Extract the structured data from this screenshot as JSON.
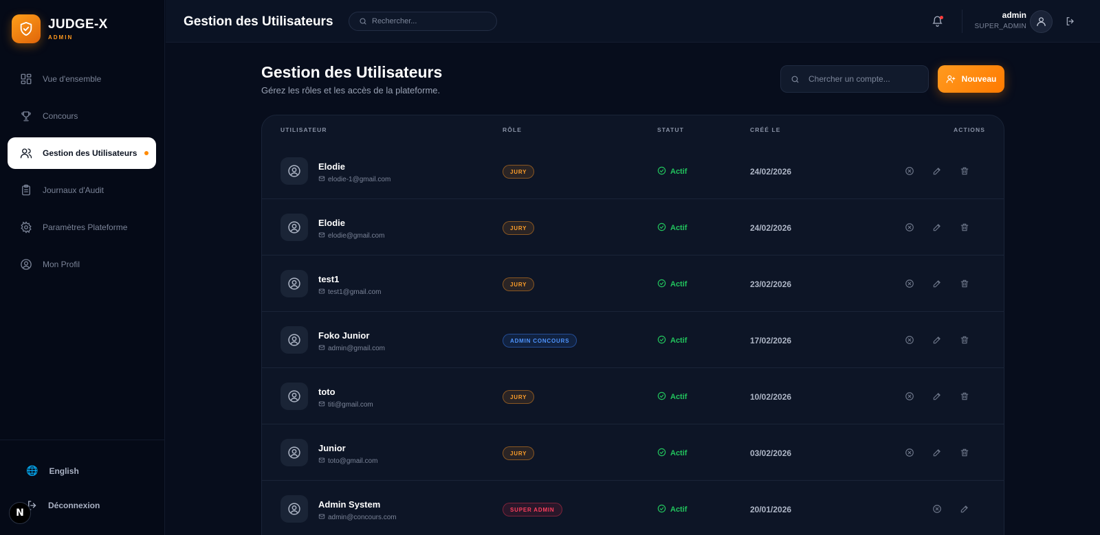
{
  "app": {
    "brand_name": "JUDGE-X",
    "brand_sub": "ADMIN",
    "accent": "#ff8a00"
  },
  "sidebar": {
    "items": [
      {
        "label": "Vue d'ensemble",
        "icon": "grid-icon"
      },
      {
        "label": "Concours",
        "icon": "trophy-icon"
      },
      {
        "label": "Gestion des Utilisateurs",
        "icon": "users-icon",
        "active": true
      },
      {
        "label": "Journaux d'Audit",
        "icon": "clipboard-icon"
      },
      {
        "label": "Paramètres Plateforme",
        "icon": "gear-icon"
      },
      {
        "label": "Mon Profil",
        "icon": "user-circle-icon"
      }
    ],
    "language": "English",
    "logout": "Déconnexion",
    "badge": "N"
  },
  "topbar": {
    "title": "Gestion des Utilisateurs",
    "search_placeholder": "Rechercher...",
    "user_name": "admin",
    "user_role": "SUPER_ADMIN"
  },
  "main": {
    "title": "Gestion des Utilisateurs",
    "subtitle": "Gérez les rôles et les accès de la plateforme.",
    "search_placeholder": "Chercher un compte...",
    "new_button": "Nouveau"
  },
  "table": {
    "columns": [
      "UTILISATEUR",
      "RÔLE",
      "STATUT",
      "CRÉÉ LE",
      "ACTIONS"
    ],
    "rows": [
      {
        "name": "Elodie",
        "email": "elodie-1@gmail.com",
        "role": "JURY",
        "role_type": "jury",
        "status": "Actif",
        "created": "24/02/2026",
        "deletable": true
      },
      {
        "name": "Elodie",
        "email": "elodie@gmail.com",
        "role": "JURY",
        "role_type": "jury",
        "status": "Actif",
        "created": "24/02/2026",
        "deletable": true
      },
      {
        "name": "test1",
        "email": "test1@gmail.com",
        "role": "JURY",
        "role_type": "jury",
        "status": "Actif",
        "created": "23/02/2026",
        "deletable": true
      },
      {
        "name": "Foko Junior",
        "email": "admin@gmail.com",
        "role": "ADMIN CONCOURS",
        "role_type": "admin-concours",
        "status": "Actif",
        "created": "17/02/2026",
        "deletable": true
      },
      {
        "name": "toto",
        "email": "titi@gmail.com",
        "role": "JURY",
        "role_type": "jury",
        "status": "Actif",
        "created": "10/02/2026",
        "deletable": true
      },
      {
        "name": "Junior",
        "email": "toto@gmail.com",
        "role": "JURY",
        "role_type": "jury",
        "status": "Actif",
        "created": "03/02/2026",
        "deletable": true
      },
      {
        "name": "Admin System",
        "email": "admin@concours.com",
        "role": "SUPER ADMIN",
        "role_type": "super",
        "status": "Actif",
        "created": "20/01/2026",
        "deletable": false
      }
    ]
  }
}
